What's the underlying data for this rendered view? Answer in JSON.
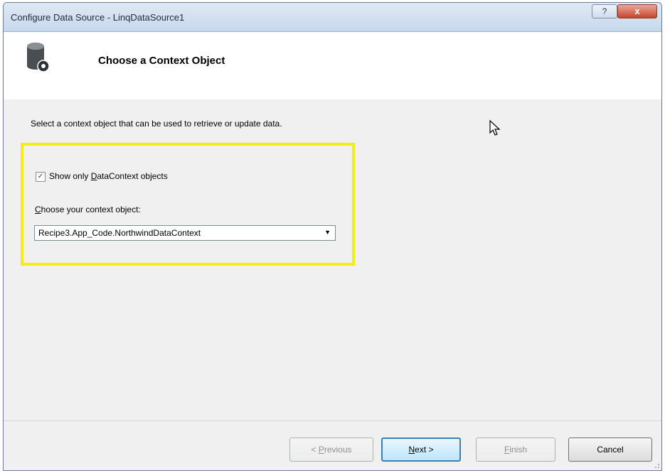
{
  "window": {
    "title": "Configure Data Source - LinqDataSource1",
    "help_label": "?",
    "close_label": "x"
  },
  "header": {
    "title": "Choose a Context Object",
    "icon": "database-icon"
  },
  "instruction": "Select a context object that can be used to retrieve or update data.",
  "checkbox": {
    "checked": true,
    "check_mark": "✓",
    "label_before": "Show only ",
    "label_mnemonic": "D",
    "label_after": "ataContext objects"
  },
  "context_select": {
    "label_mnemonic": "C",
    "label_rest": "hoose your context object:",
    "value": "Recipe3.App_Code.NorthwindDataContext",
    "arrow": "▼"
  },
  "buttons": {
    "previous": {
      "prefix": "< ",
      "mnemonic": "P",
      "rest": "revious",
      "enabled": false
    },
    "next": {
      "mnemonic": "N",
      "rest": "ext >",
      "enabled": true
    },
    "finish": {
      "mnemonic": "F",
      "rest": "inish",
      "enabled": false
    },
    "cancel": {
      "label": "Cancel",
      "enabled": true
    }
  },
  "colors": {
    "highlight": "#f5ec12",
    "primary_button_border": "#3c7fb1",
    "close_button": "#c8442c"
  }
}
